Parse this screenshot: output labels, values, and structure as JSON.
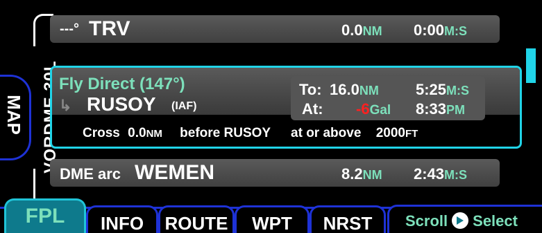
{
  "side": {
    "approach_label": "VORDME 30L",
    "map_label": "MAP"
  },
  "rows": {
    "top": {
      "leg": "---°",
      "waypoint": "TRV",
      "dist": "0.0",
      "dist_unit": "NM",
      "ete": "0:00",
      "ete_unit": "M:S"
    },
    "active": {
      "title": "Fly Direct (147°)",
      "waypoint": "RUSOY",
      "waypoint_tag": "(IAF)",
      "to_label": "To:",
      "to_value": "16.0",
      "to_unit": "NM",
      "ete": "5:25",
      "ete_unit": "M:S",
      "at_label": "At:",
      "fuel_value": "-6",
      "fuel_unit": "Gal",
      "eta": "8:33",
      "eta_unit": "PM",
      "cross_label": "Cross",
      "cross_value": "0.0",
      "cross_unit": "NM",
      "before_text": "before RUSOY",
      "constraint": "at or above",
      "altitude": "2000",
      "altitude_unit": "FT"
    },
    "bottom": {
      "leg_prefix": "DME arc",
      "waypoint": "WEMEN",
      "dist": "8.2",
      "dist_unit": "NM",
      "ete": "2:43",
      "ete_unit": "M:S"
    }
  },
  "tabs": [
    "FPL",
    "INFO",
    "ROUTE",
    "WPT",
    "NRST"
  ],
  "footer": {
    "scroll": "Scroll",
    "select": "Select"
  },
  "colors": {
    "accent_cyan": "#20d4e8",
    "tab_blue": "#1e32d6",
    "unit_green": "#7de0bb",
    "warning_red": "#ff2020"
  }
}
